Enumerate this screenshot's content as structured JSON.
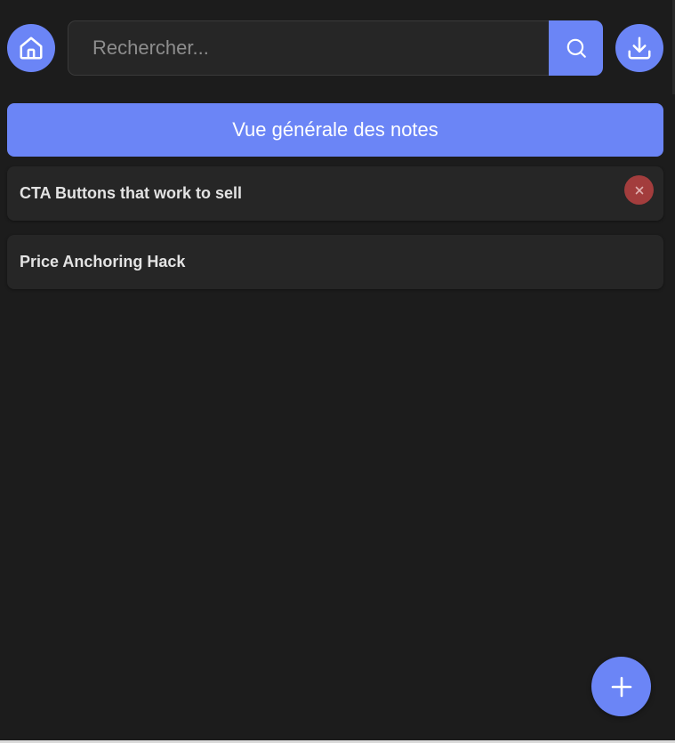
{
  "header": {
    "home_icon": "home-icon",
    "search": {
      "placeholder": "Rechercher...",
      "value": "",
      "icon": "search-icon"
    },
    "download_icon": "download-icon"
  },
  "overview": {
    "label": "Vue générale des notes"
  },
  "notes": [
    {
      "title": "CTA Buttons that work to sell",
      "delete_icon": "close-icon"
    },
    {
      "title": "Price Anchoring Hack"
    }
  ],
  "fab": {
    "icon": "plus-icon"
  },
  "colors": {
    "accent": "#6b85f6",
    "background": "#1c1c1c",
    "card": "#262626",
    "danger": "#a33d3d"
  }
}
